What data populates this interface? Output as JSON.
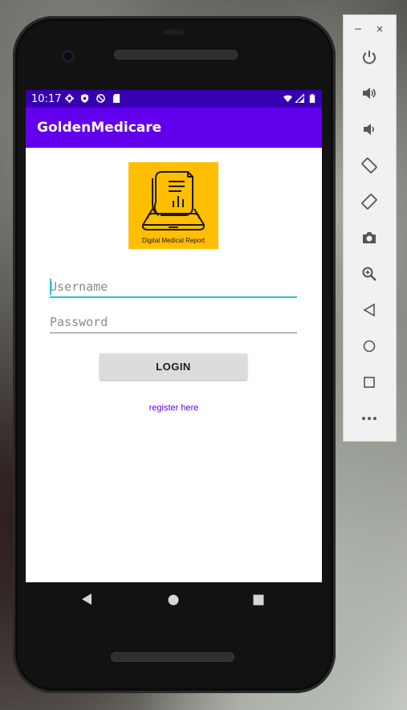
{
  "status_bar": {
    "time": "10:17",
    "icons": [
      "settings-icon",
      "shield-icon",
      "no-sync-icon",
      "sd-card-icon",
      "wifi-icon",
      "signal-icon",
      "battery-icon"
    ]
  },
  "app_bar": {
    "title": "GoldenMedicare"
  },
  "logo": {
    "caption": "Digital Medical Report",
    "background": "#ffbe00"
  },
  "login_form": {
    "username": {
      "value": "",
      "placeholder": "Username"
    },
    "password": {
      "value": "",
      "placeholder": "Password"
    },
    "login_label": "LOGIN",
    "register_label": "register here"
  },
  "navigation_bar": {
    "buttons": [
      "back-icon",
      "home-icon",
      "recents-icon"
    ]
  },
  "emulator_panel": {
    "minimize": "−",
    "close": "×",
    "tools": [
      "power-icon",
      "volume-up-icon",
      "volume-down-icon",
      "rotate-left-icon",
      "rotate-right-icon",
      "screenshot-icon",
      "zoom-icon",
      "back-icon",
      "home-icon",
      "overview-icon",
      "more-icon"
    ]
  },
  "colors": {
    "primary": "#6200ee",
    "primary_dark": "#3700b3",
    "accent": "#26c6c6",
    "button": "#dcdcdc"
  }
}
